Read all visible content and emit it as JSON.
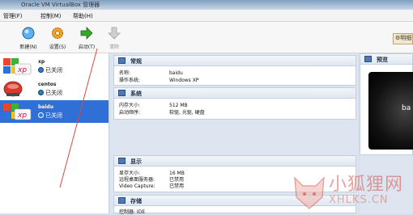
{
  "window": {
    "title": "Oracle VM VirtualBox 管理器"
  },
  "menu": [
    {
      "label": "管理(F)"
    },
    {
      "label": "控制(M)"
    },
    {
      "label": "帮助(H)"
    }
  ],
  "toolbar": {
    "new_label": "新建(N)",
    "settings_label": "设置(S)",
    "start_label": "启动(T)",
    "discard_label": "清除",
    "right_btn_label": "明细"
  },
  "vms": [
    {
      "name": "xp",
      "state": "已关闭",
      "logo": "xp-logo"
    },
    {
      "name": "centos",
      "state": "已关闭",
      "logo": "centos-logo"
    },
    {
      "name": "baidu",
      "state": "已关闭",
      "logo": "xp-logo",
      "selected": true
    }
  ],
  "details": {
    "general": {
      "title": "常规",
      "name_key": "名称:",
      "name_val": "baidu",
      "os_key": "操作系统:",
      "os_val": "Windows XP"
    },
    "system": {
      "title": "系统",
      "mem_key": "内存大小:",
      "mem_val": "512 MB",
      "boot_key": "启动顺序:",
      "boot_val": "软驱, 光驱, 硬盘"
    },
    "display": {
      "title": "显示",
      "vram_key": "显存大小:",
      "vram_val": "16 MB",
      "rdp_key": "远程桌面服务器:",
      "rdp_val": "已禁用",
      "capture_key": "Video Capture:",
      "capture_val": "已禁用"
    },
    "storage": {
      "title": "存储",
      "ctrl_key": "控制器: IDE"
    }
  },
  "preview": {
    "title": "预览",
    "screen_text": "ba"
  },
  "watermark": {
    "cn": "小狐狸网",
    "en": "XHLKS.CN"
  },
  "colors": {
    "selection": "#2f6fd6",
    "accent_arrow": "#3aa52c",
    "annotation": "#d94b3b"
  }
}
